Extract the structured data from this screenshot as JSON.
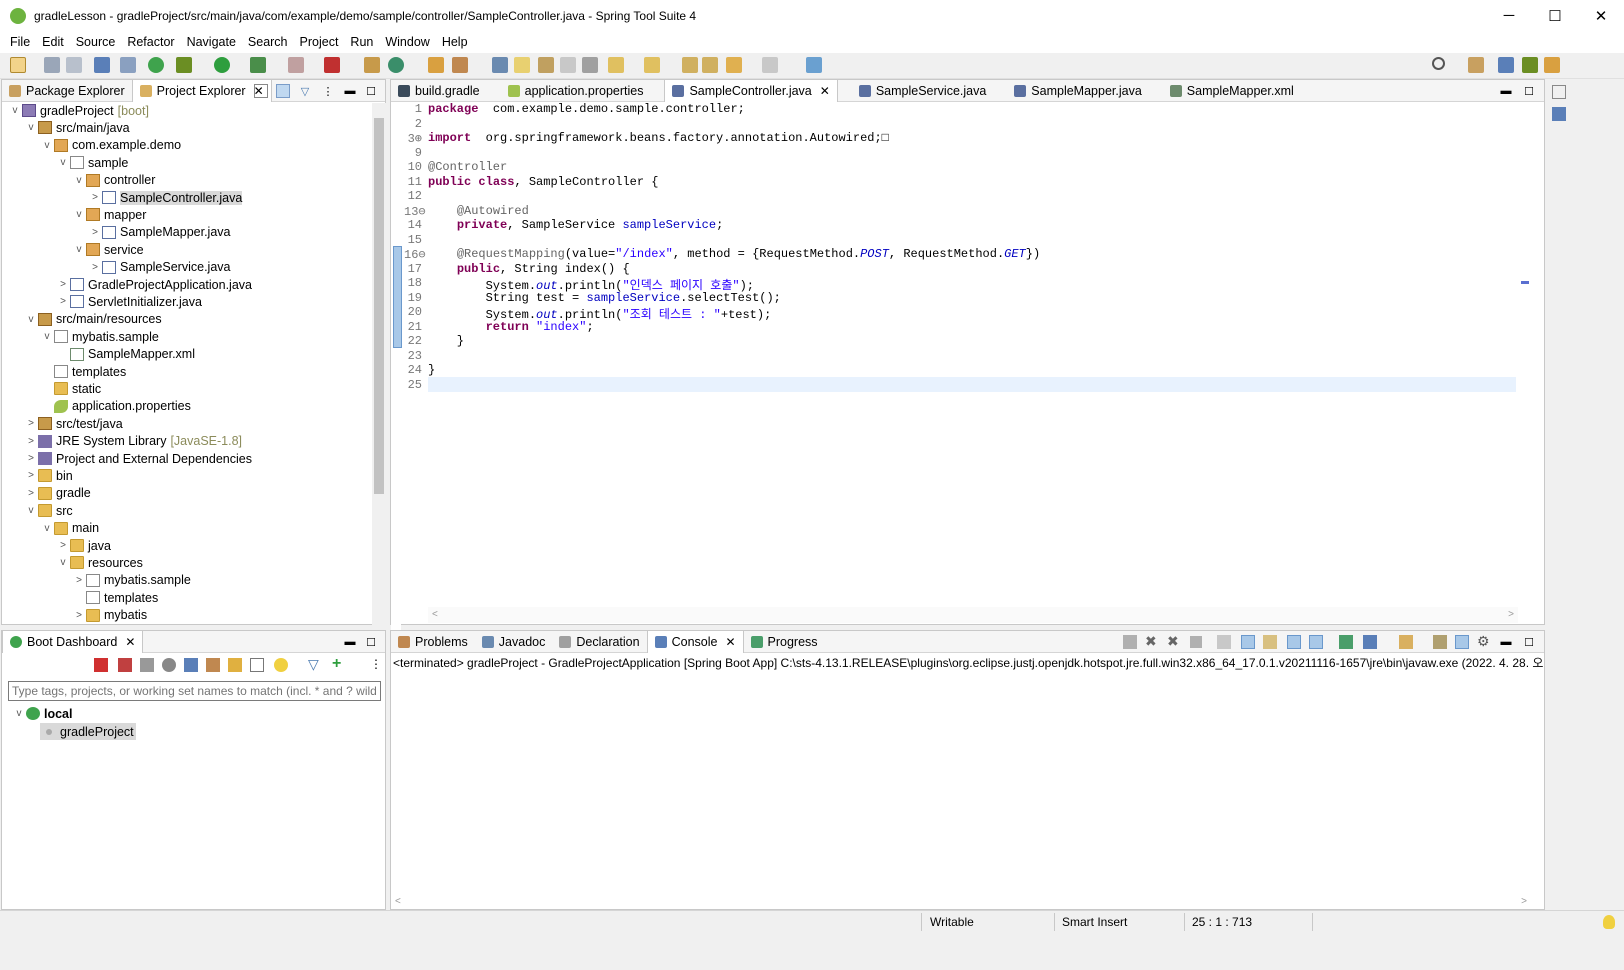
{
  "window": {
    "title": "gradleLesson - gradleProject/src/main/java/com/example/demo/sample/controller/SampleController.java - Spring Tool Suite 4",
    "minimize": "─",
    "maximize": "☐",
    "close": "✕"
  },
  "menu": [
    "File",
    "Edit",
    "Source",
    "Refactor",
    "Navigate",
    "Search",
    "Project",
    "Run",
    "Window",
    "Help"
  ],
  "explorer": {
    "tabs": [
      "Package Explorer",
      "Project Explorer"
    ],
    "tree": [
      {
        "label": "gradleProject",
        "decor": "[boot]",
        "indent": 0,
        "arrow": "v",
        "icon": "proj",
        "sel": false
      },
      {
        "label": "src/main/java",
        "indent": 1,
        "arrow": "v",
        "icon": "jar",
        "sel": false
      },
      {
        "label": "com.example.demo",
        "indent": 2,
        "arrow": "v",
        "icon": "pkg",
        "sel": false
      },
      {
        "label": "sample",
        "indent": 3,
        "arrow": "v",
        "icon": "pkg-empty",
        "sel": false
      },
      {
        "label": "controller",
        "indent": 4,
        "arrow": "v",
        "icon": "pkg",
        "sel": false
      },
      {
        "label": "SampleController.java",
        "indent": 5,
        "arrow": ">",
        "icon": "java",
        "sel": true
      },
      {
        "label": "mapper",
        "indent": 4,
        "arrow": "v",
        "icon": "pkg",
        "sel": false
      },
      {
        "label": "SampleMapper.java",
        "indent": 5,
        "arrow": ">",
        "icon": "java",
        "sel": false
      },
      {
        "label": "service",
        "indent": 4,
        "arrow": "v",
        "icon": "pkg",
        "sel": false
      },
      {
        "label": "SampleService.java",
        "indent": 5,
        "arrow": ">",
        "icon": "java",
        "sel": false
      },
      {
        "label": "GradleProjectApplication.java",
        "indent": 3,
        "arrow": ">",
        "icon": "java",
        "sel": false
      },
      {
        "label": "ServletInitializer.java",
        "indent": 3,
        "arrow": ">",
        "icon": "java",
        "sel": false
      },
      {
        "label": "src/main/resources",
        "indent": 1,
        "arrow": "v",
        "icon": "jar",
        "sel": false
      },
      {
        "label": "mybatis.sample",
        "indent": 2,
        "arrow": "v",
        "icon": "pkg-empty",
        "sel": false
      },
      {
        "label": "SampleMapper.xml",
        "indent": 3,
        "arrow": "",
        "icon": "xml",
        "sel": false
      },
      {
        "label": "templates",
        "indent": 2,
        "arrow": "",
        "icon": "pkg-empty",
        "sel": false
      },
      {
        "label": "static",
        "indent": 2,
        "arrow": "",
        "icon": "folder",
        "sel": false
      },
      {
        "label": "application.properties",
        "indent": 2,
        "arrow": "",
        "icon": "props",
        "sel": false
      },
      {
        "label": "src/test/java",
        "indent": 1,
        "arrow": ">",
        "icon": "jar",
        "sel": false
      },
      {
        "label": "JRE System Library",
        "decor": "[JavaSE-1.8]",
        "indent": 1,
        "arrow": ">",
        "icon": "lib",
        "sel": false
      },
      {
        "label": "Project and External Dependencies",
        "indent": 1,
        "arrow": ">",
        "icon": "lib",
        "sel": false
      },
      {
        "label": "bin",
        "indent": 1,
        "arrow": ">",
        "icon": "folder",
        "sel": false
      },
      {
        "label": "gradle",
        "indent": 1,
        "arrow": ">",
        "icon": "folder",
        "sel": false
      },
      {
        "label": "src",
        "indent": 1,
        "arrow": "v",
        "icon": "folder",
        "sel": false
      },
      {
        "label": "main",
        "indent": 2,
        "arrow": "v",
        "icon": "folder",
        "sel": false
      },
      {
        "label": "java",
        "indent": 3,
        "arrow": ">",
        "icon": "folder",
        "sel": false
      },
      {
        "label": "resources",
        "indent": 3,
        "arrow": "v",
        "icon": "folder",
        "sel": false
      },
      {
        "label": "mybatis.sample",
        "indent": 4,
        "arrow": ">",
        "icon": "pkg-empty",
        "sel": false
      },
      {
        "label": "templates",
        "indent": 4,
        "arrow": "",
        "icon": "pkg-empty",
        "sel": false
      },
      {
        "label": "mybatis",
        "indent": 4,
        "arrow": ">",
        "icon": "folder",
        "sel": false
      }
    ]
  },
  "boot": {
    "tab": "Boot Dashboard",
    "filter_placeholder": "Type tags, projects, or working set names to match (incl. * and ? wildc",
    "local": "local",
    "project": "gradleProject"
  },
  "editor": {
    "tabs": [
      "build.gradle",
      "application.properties",
      "SampleController.java",
      "SampleService.java",
      "SampleMapper.java",
      "SampleMapper.xml"
    ],
    "active_tab": "SampleController.java",
    "lines": [
      {
        "n": "1",
        "h": [
          [
            "kw",
            "package"
          ],
          [
            "",
            "  com.example.demo.sample.controller;"
          ]
        ]
      },
      {
        "n": "2",
        "h": []
      },
      {
        "n": "3⊕",
        "h": [
          [
            "kw",
            "import"
          ],
          [
            "",
            "  org.springframework.beans.factory.annotation.Autowired;□"
          ]
        ]
      },
      {
        "n": "9",
        "h": []
      },
      {
        "n": "10",
        "h": [
          [
            "ann",
            "@Controller"
          ]
        ]
      },
      {
        "n": "11",
        "h": [
          [
            "kw",
            "public"
          ],
          [
            "",
            " "
          ],
          [
            "kw",
            "class"
          ],
          [
            "",
            ", SampleController {"
          ]
        ]
      },
      {
        "n": "12",
        "h": []
      },
      {
        "n": "13⊖",
        "h": [
          [
            "",
            "    "
          ],
          [
            "ann",
            "@Autowired"
          ]
        ]
      },
      {
        "n": "14",
        "h": [
          [
            "",
            "    "
          ],
          [
            "kw",
            "private"
          ],
          [
            "",
            ", SampleService "
          ],
          [
            "fld",
            "sampleService"
          ],
          [
            "",
            ";"
          ]
        ]
      },
      {
        "n": "15",
        "h": []
      },
      {
        "n": "16⊖",
        "h": [
          [
            "",
            "    "
          ],
          [
            "ann",
            "@RequestMapping"
          ],
          [
            "",
            "(value="
          ],
          [
            "str",
            "\"/index\""
          ],
          [
            "",
            ", method = {RequestMethod."
          ],
          [
            "ital",
            "POST"
          ],
          [
            "",
            ", RequestMethod."
          ],
          [
            "ital",
            "GET"
          ],
          [
            "",
            "})"
          ]
        ]
      },
      {
        "n": "17",
        "h": [
          [
            "",
            "    "
          ],
          [
            "kw",
            "public"
          ],
          [
            "",
            ", String index() {"
          ]
        ]
      },
      {
        "n": "18",
        "h": [
          [
            "",
            "        System."
          ],
          [
            "ital",
            "out"
          ],
          [
            "",
            ".println("
          ],
          [
            "str",
            "\"인덱스 페이지 호출\""
          ],
          [
            "",
            ");"
          ]
        ]
      },
      {
        "n": "19",
        "h": [
          [
            "",
            "        String test = "
          ],
          [
            "fld",
            "sampleService"
          ],
          [
            "",
            ".selectTest();"
          ]
        ]
      },
      {
        "n": "20",
        "h": [
          [
            "",
            "        System."
          ],
          [
            "ital",
            "out"
          ],
          [
            "",
            ".println("
          ],
          [
            "str",
            "\"조회 테스트 : \""
          ],
          [
            "",
            "+test);"
          ]
        ]
      },
      {
        "n": "21",
        "h": [
          [
            "",
            "        "
          ],
          [
            "kw",
            "return"
          ],
          [
            "",
            " "
          ],
          [
            "str",
            "\"index\""
          ],
          [
            "",
            ";"
          ]
        ]
      },
      {
        "n": "22",
        "h": [
          [
            "",
            "    }"
          ]
        ]
      },
      {
        "n": "23",
        "h": []
      },
      {
        "n": "24",
        "h": [
          [
            "",
            "}"
          ]
        ]
      },
      {
        "n": "25",
        "h": []
      }
    ]
  },
  "console": {
    "tabs": [
      "Problems",
      "Javadoc",
      "Declaration",
      "Console",
      "Progress"
    ],
    "terminated": "<terminated> gradleProject - GradleProjectApplication [Spring Boot App] C:\\sts-4.13.1.RELEASE\\plugins\\org.eclipse.justj.openjdk.hotspot.jre.full.win32.x86_64_17.0.1.v20211116-1657\\jre\\bin\\javaw.exe  (2022. 4. 28. 오"
  },
  "status": {
    "writable": "Writable",
    "insert": "Smart Insert",
    "position": "25 : 1 : 713"
  }
}
